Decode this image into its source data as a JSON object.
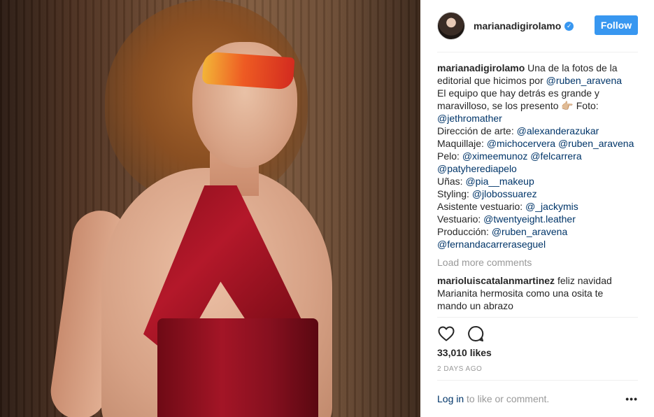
{
  "post": {
    "username": "marianadigirolamo",
    "verified_mark": "✓",
    "follow_label": "Follow"
  },
  "caption": {
    "author": "marianadigirolamo",
    "lines": [
      [
        "Una de la fotos de la",
        ""
      ],
      [
        "editorial que hicimos por ",
        "@ruben_aravena"
      ],
      [
        "El equipo que hay detrás es grande y",
        ""
      ],
      [
        "maravilloso, se los presento 👉🏼 Foto:",
        ""
      ],
      [
        "",
        "@jethromather"
      ],
      [
        "Dirección de arte: ",
        "@alexanderazukar"
      ],
      [
        "Maquillaje: ",
        "@michocervera @ruben_aravena"
      ],
      [
        "Pelo: ",
        "@ximeemunoz @felcarrera"
      ],
      [
        "",
        "@patyherediapelo"
      ],
      [
        "Uñas: ",
        "@pia__makeup"
      ],
      [
        "Styling: ",
        "@jlobossuarez"
      ],
      [
        "Asistente vestuario: ",
        "@_jackymis"
      ],
      [
        "Vestuario: ",
        "@twentyeight.leather"
      ],
      [
        "Producción: ",
        "@ruben_aravena"
      ],
      [
        "",
        "@fernandacarreraseguel"
      ]
    ]
  },
  "load_more": "Load more comments",
  "comment": {
    "author": "marioluiscatalanmartinez",
    "line1": "feliz navidad",
    "line2": "Marianita hermosita como una osita te",
    "line3": "mando un abrazo"
  },
  "likes": "33,010 likes",
  "timestamp": "2 DAYS AGO",
  "login": {
    "link": "Log in",
    "rest": " to like or comment.",
    "more": "•••"
  },
  "icons": {
    "like": "heart-icon",
    "comment": "comment-bubble-icon"
  }
}
